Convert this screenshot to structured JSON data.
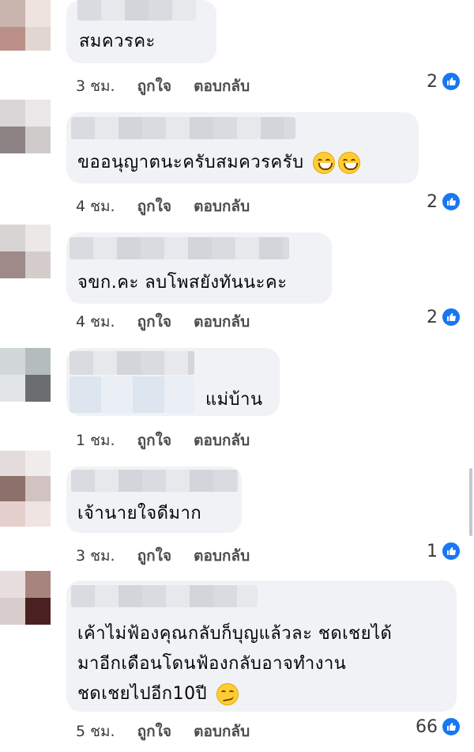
{
  "comments": [
    {
      "text_lines": [
        "สมควรคะ"
      ],
      "time": "3 ชม.",
      "like_label": "ถูกใจ",
      "reply_label": "ตอบกลับ",
      "reaction_count": "2"
    },
    {
      "text_lines": [
        "ขออนุญาตนะครับสมควรครับ"
      ],
      "time": "4 ชม.",
      "like_label": "ถูกใจ",
      "reply_label": "ตอบกลับ",
      "reaction_count": "2",
      "emoji": [
        "grinning-face-icon",
        "grinning-face-icon"
      ]
    },
    {
      "text_lines": [
        "จขก.คะ  ลบโพสยังทันนะคะ"
      ],
      "time": "4 ชม.",
      "like_label": "ถูกใจ",
      "reply_label": "ตอบกลับ",
      "reaction_count": "2"
    },
    {
      "text_lines": [
        "แม่บ้าน"
      ],
      "time": "1 ชม.",
      "like_label": "ถูกใจ",
      "reply_label": "ตอบกลับ"
    },
    {
      "text_lines": [
        "เจ้านายใจดีมาก"
      ],
      "time": "3 ชม.",
      "like_label": "ถูกใจ",
      "reply_label": "ตอบกลับ",
      "reaction_count": "1"
    },
    {
      "text_lines": [
        "เค้าไม่ฟ้องคุณกลับก็บุญแล้วละ ชดเชยได้",
        "มาอีกเดือนโดนฟ้องกลับอาจทำงาน",
        "ชดเชยไปอีก10ปี"
      ],
      "time": "5 ชม.",
      "like_label": "ถูกใจ",
      "reply_label": "ตอบกลับ",
      "reaction_count": "66",
      "emoji": [
        "smirking-face-icon"
      ]
    }
  ],
  "colors": {
    "bubble": "#f0f2f5",
    "like_badge": "#1877f2"
  }
}
